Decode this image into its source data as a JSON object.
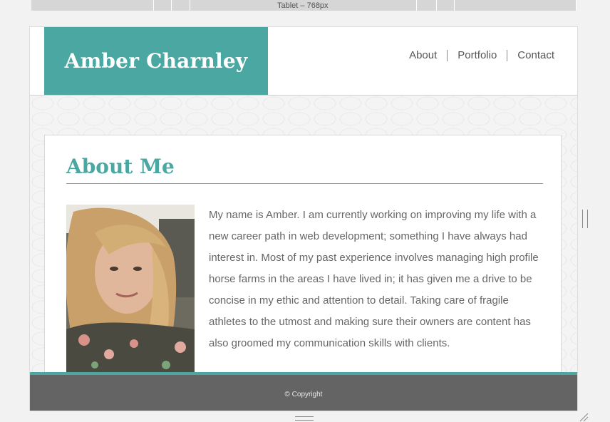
{
  "toolbar": {
    "device_label": "Tablet – 768px"
  },
  "header": {
    "brand": "Amber Charnley",
    "nav": [
      "About",
      "Portfolio",
      "Contact"
    ]
  },
  "about": {
    "heading": "About Me",
    "bio": "My name is Amber. I am currently working on improving my life with a new career path in web development; something I have always had interest in. Most of my past experience involves managing high profile horse farms in the areas I have lived in; it has given me a drive to be concise in my ethic and attention to detail. Taking care of fragile athletes to the utmost and making sure their owners are content has also groomed my communication skills with clients."
  },
  "footer": {
    "copyright": "© Copyright"
  },
  "colors": {
    "accent": "#4aa7a2",
    "footer": "#646464",
    "text": "#666666"
  }
}
